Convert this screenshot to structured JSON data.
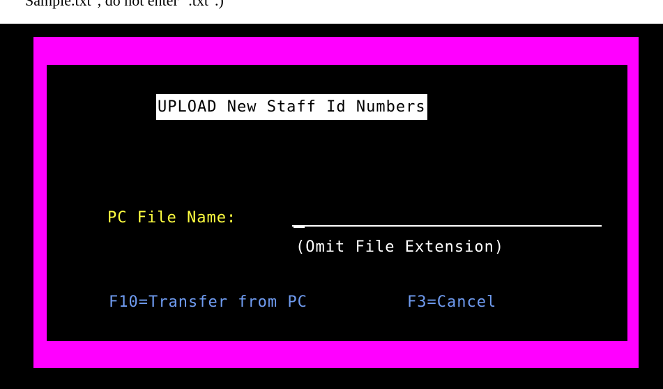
{
  "header": {
    "instruction_fragment": "Sample.txt\", do not enter \".txt\".)"
  },
  "screen": {
    "title": "UPLOAD New Staff Id Numbers",
    "pc_file_name": {
      "label": "PC File Name:",
      "value": "",
      "hint": "(Omit File Extension)"
    },
    "function_keys": {
      "transfer_label": "F10=Transfer from PC",
      "cancel_label": "F3=Cancel"
    }
  },
  "colors": {
    "frame": "#ff00ff",
    "background": "#000000",
    "field_label": "#ffff40",
    "function_keys": "#6f9bf0",
    "title_background": "#ffffff"
  }
}
